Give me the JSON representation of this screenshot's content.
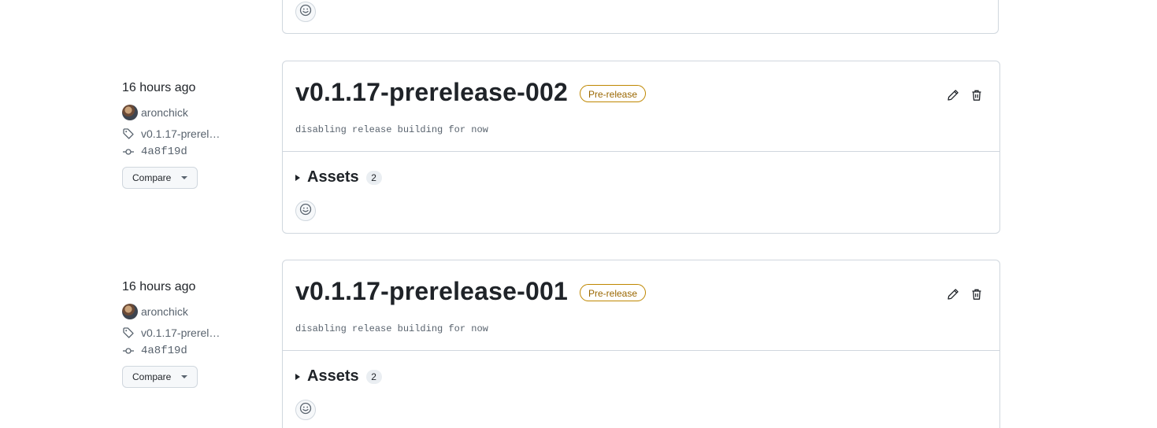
{
  "releases": [
    {
      "time": "16 hours ago",
      "author": "aronchick",
      "tag": "v0.1.17-prerel…",
      "commit": "4a8f19d",
      "compare_label": "Compare",
      "title": "v0.1.17-prerelease-002",
      "badge": "Pre-release",
      "body": "disabling release building for now",
      "assets_label": "Assets",
      "assets_count": "2"
    },
    {
      "time": "16 hours ago",
      "author": "aronchick",
      "tag": "v0.1.17-prerel…",
      "commit": "4a8f19d",
      "compare_label": "Compare",
      "title": "v0.1.17-prerelease-001",
      "badge": "Pre-release",
      "body": "disabling release building for now",
      "assets_label": "Assets",
      "assets_count": "2"
    }
  ],
  "icons": {
    "reaction": "smiley-icon",
    "edit": "pencil-icon",
    "delete": "trash-icon",
    "tag": "tag-icon",
    "commit": "git-commit-icon"
  },
  "colors": {
    "prerelease_border": "#bf8700",
    "prerelease_text": "#9a6700",
    "border": "#d0d7de"
  }
}
